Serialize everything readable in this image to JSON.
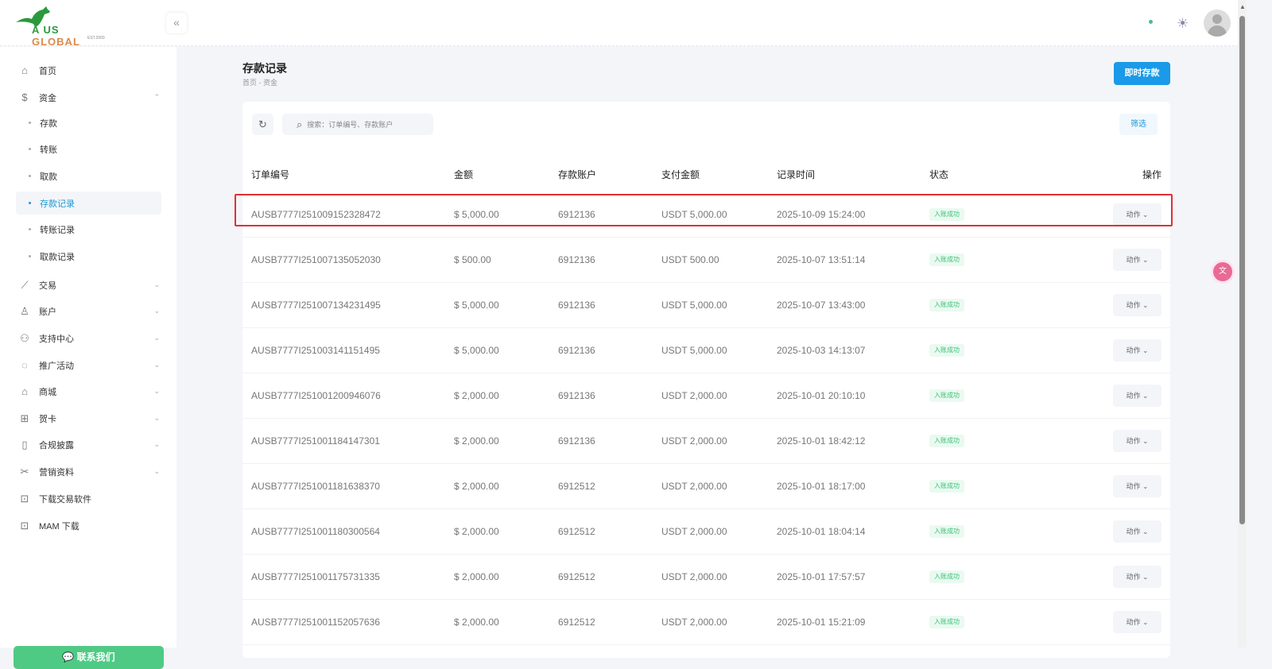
{
  "header": {
    "logo_text": "AUS GLOBAL",
    "logo_est": "EST.2003",
    "collapse_icon": "«"
  },
  "sidebar": {
    "items": [
      {
        "label": "首页",
        "icon": "home-icon",
        "glyph": "⌂"
      },
      {
        "label": "资金",
        "icon": "dollar-icon",
        "glyph": "$"
      },
      {
        "label": "存款"
      },
      {
        "label": "转账"
      },
      {
        "label": "取款"
      },
      {
        "label": "存款记录"
      },
      {
        "label": "转账记录"
      },
      {
        "label": "取款记录"
      },
      {
        "label": "交易",
        "icon": "chart-icon",
        "glyph": "⟋"
      },
      {
        "label": "账户",
        "icon": "user-icon",
        "glyph": "♙"
      },
      {
        "label": "支持中心",
        "icon": "support-icon",
        "glyph": "⚇"
      },
      {
        "label": "推广活动",
        "icon": "promo-icon",
        "glyph": "◌"
      },
      {
        "label": "商城",
        "icon": "store-icon",
        "glyph": "⌂"
      },
      {
        "label": "贺卡",
        "icon": "gift-icon",
        "glyph": "⊞"
      },
      {
        "label": "合规披露",
        "icon": "document-icon",
        "glyph": "▯"
      },
      {
        "label": "营销资料",
        "icon": "tools-icon",
        "glyph": "✂"
      },
      {
        "label": "下载交易软件",
        "icon": "download-icon",
        "glyph": "⊡"
      },
      {
        "label": "MAM 下载",
        "icon": "download-icon",
        "glyph": "⊡"
      }
    ],
    "contact_label": "联系我们"
  },
  "page": {
    "title": "存款记录",
    "breadcrumb": "首页 - 资金",
    "deposit_button": "即时存款",
    "search_placeholder": "搜索：订单编号、存款账户",
    "filter_button": "筛选"
  },
  "table": {
    "columns": [
      "订单编号",
      "金额",
      "存款账户",
      "支付金额",
      "记录时间",
      "状态",
      "操作"
    ],
    "rows": [
      {
        "order": "AUSB7777I251009152328472",
        "amount": "$ 5,000.00",
        "account": "6912136",
        "paid": "USDT 5,000.00",
        "time": "2025-10-09 15:24:00",
        "status": "入账成功",
        "action": "动作"
      },
      {
        "order": "AUSB7777I251007135052030",
        "amount": "$ 500.00",
        "account": "6912136",
        "paid": "USDT 500.00",
        "time": "2025-10-07 13:51:14",
        "status": "入账成功",
        "action": "动作"
      },
      {
        "order": "AUSB7777I251007134231495",
        "amount": "$ 5,000.00",
        "account": "6912136",
        "paid": "USDT 5,000.00",
        "time": "2025-10-07 13:43:00",
        "status": "入账成功",
        "action": "动作"
      },
      {
        "order": "AUSB7777I251003141151495",
        "amount": "$ 5,000.00",
        "account": "6912136",
        "paid": "USDT 5,000.00",
        "time": "2025-10-03 14:13:07",
        "status": "入账成功",
        "action": "动作"
      },
      {
        "order": "AUSB7777I251001200946076",
        "amount": "$ 2,000.00",
        "account": "6912136",
        "paid": "USDT 2,000.00",
        "time": "2025-10-01 20:10:10",
        "status": "入账成功",
        "action": "动作"
      },
      {
        "order": "AUSB7777I251001184147301",
        "amount": "$ 2,000.00",
        "account": "6912136",
        "paid": "USDT 2,000.00",
        "time": "2025-10-01 18:42:12",
        "status": "入账成功",
        "action": "动作"
      },
      {
        "order": "AUSB7777I251001181638370",
        "amount": "$ 2,000.00",
        "account": "6912512",
        "paid": "USDT 2,000.00",
        "time": "2025-10-01 18:17:00",
        "status": "入账成功",
        "action": "动作"
      },
      {
        "order": "AUSB7777I251001180300564",
        "amount": "$ 2,000.00",
        "account": "6912512",
        "paid": "USDT 2,000.00",
        "time": "2025-10-01 18:04:14",
        "status": "入账成功",
        "action": "动作"
      },
      {
        "order": "AUSB7777I251001175731335",
        "amount": "$ 2,000.00",
        "account": "6912512",
        "paid": "USDT 2,000.00",
        "time": "2025-10-01 17:57:57",
        "status": "入账成功",
        "action": "动作"
      },
      {
        "order": "AUSB7777I251001152057636",
        "amount": "$ 2,000.00",
        "account": "6912512",
        "paid": "USDT 2,000.00",
        "time": "2025-10-01 15:21:09",
        "status": "入账成功",
        "action": "动作"
      }
    ]
  },
  "colors": {
    "accent": "#1a9ae8",
    "success": "#3cc07a",
    "contact": "#4fca84",
    "highlight": "#e03131"
  }
}
